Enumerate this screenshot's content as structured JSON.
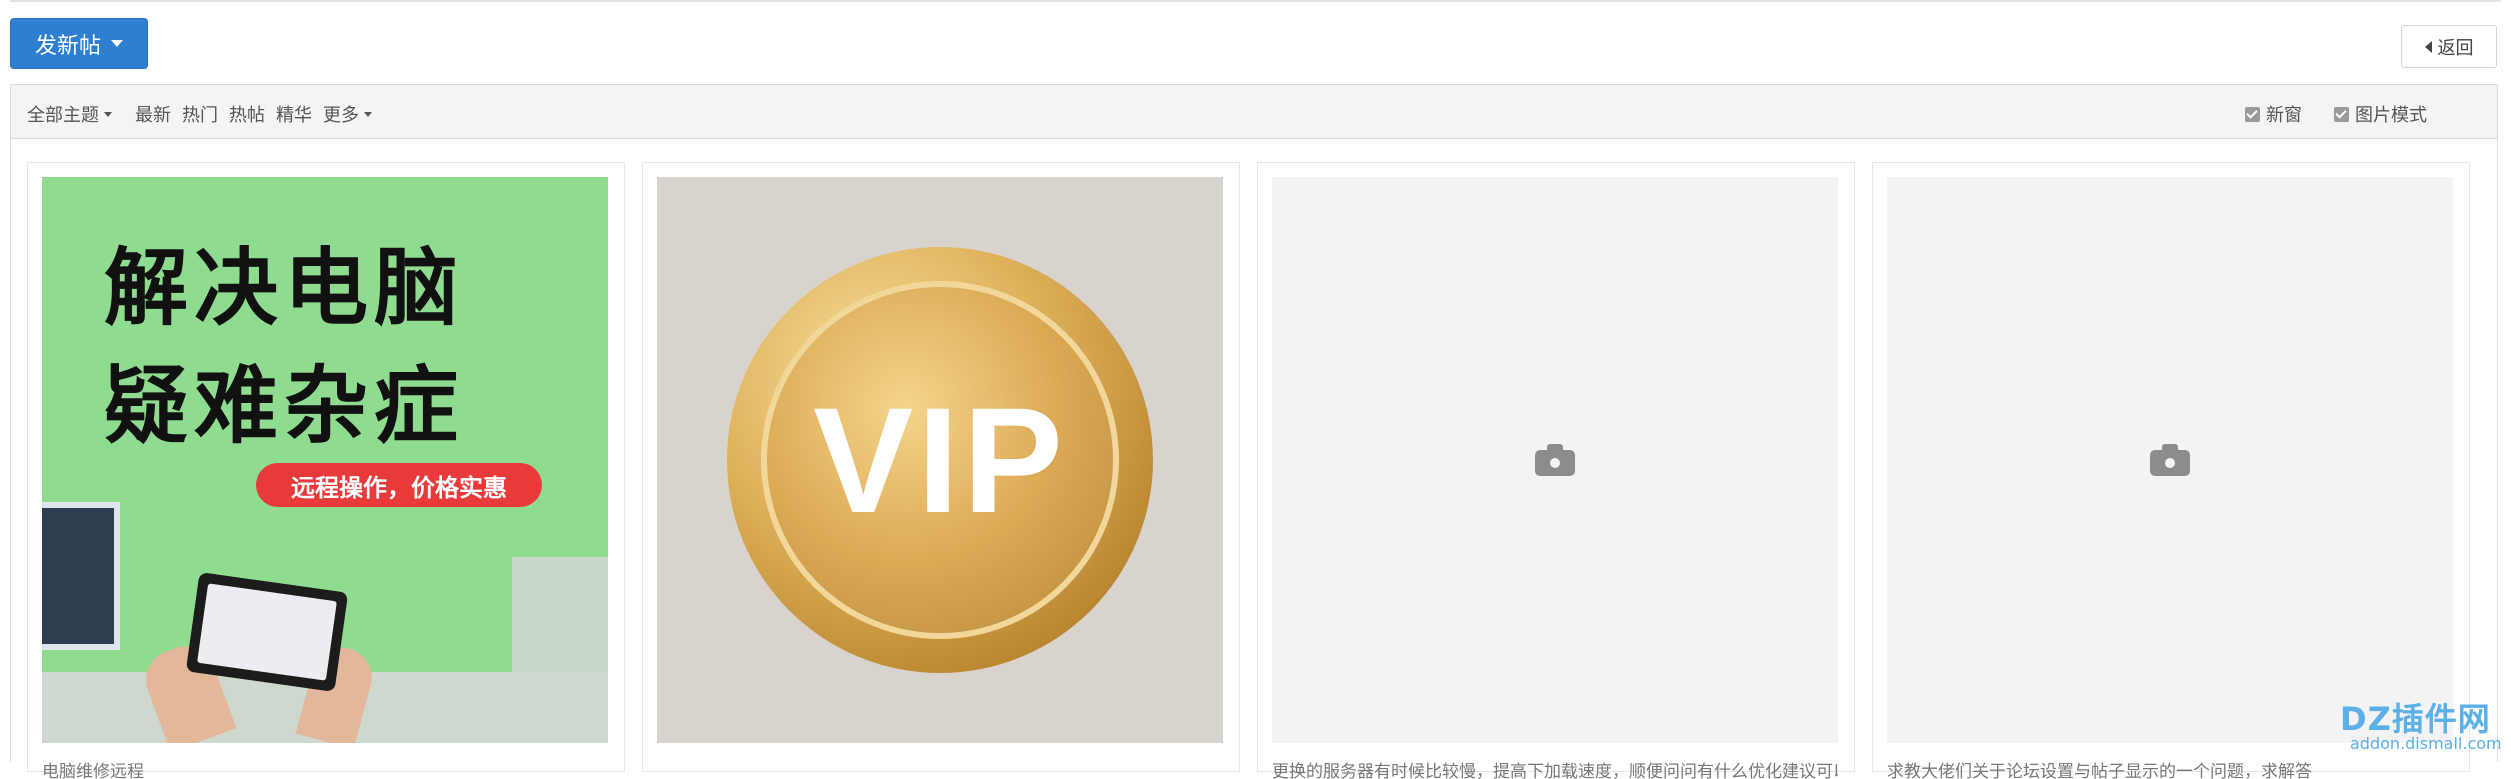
{
  "header": {
    "post_button_label": "发新帖",
    "back_button_label": "返回"
  },
  "filter_bar": {
    "items": [
      {
        "label": "全部主题",
        "has_dropdown": true
      },
      {
        "label": "最新",
        "has_dropdown": false
      },
      {
        "label": "热门",
        "has_dropdown": false
      },
      {
        "label": "热帖",
        "has_dropdown": false
      },
      {
        "label": "精华",
        "has_dropdown": false
      },
      {
        "label": "更多",
        "has_dropdown": true
      }
    ],
    "options": [
      {
        "label": "新窗",
        "checked": true
      },
      {
        "label": "图片模式",
        "checked": true
      }
    ]
  },
  "cards": [
    {
      "image": "promo-remote-repair",
      "image_text": {
        "line1": "解决电脑",
        "line2": "疑难杂症",
        "pill": "远程操作，价格实惠"
      },
      "title": "电脑维修远程"
    },
    {
      "image": "vip-gold-coin",
      "image_text": {
        "coin": "VIP"
      },
      "title": ""
    },
    {
      "image": "camera-icon",
      "title": "更换的服务器有时候比较慢，提高下加载速度，顺便问问有什么优化建议可以用"
    },
    {
      "image": "camera-icon",
      "title": "求教大佬们关于论坛设置与帖子显示的一个问题，求解答"
    }
  ],
  "watermark": {
    "main": "DZ插件网",
    "sub": "addon.dismall.com"
  },
  "colors": {
    "primary": "#2f7fd1",
    "filter_bg": "#f4f4f4",
    "coin_gold": "#dcaa55",
    "promo_green": "#8fdc90",
    "promo_red": "#e8393b"
  }
}
